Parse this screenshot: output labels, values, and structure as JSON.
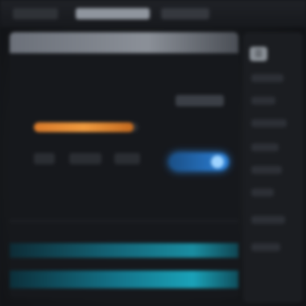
{
  "topbar": {
    "tabs": [
      "",
      "",
      ""
    ]
  },
  "main_panel": {
    "header_label": "",
    "section_label": "",
    "metric_title": "",
    "side_caption": "",
    "progress_fraction": 0.95,
    "toggle_on": true,
    "lower_label": ""
  },
  "colors": {
    "accent_orange": "#f09a3e",
    "accent_blue": "#2b7fd6",
    "accent_teal": "#1aa2b8",
    "background": "#15171b"
  },
  "right_rail": {
    "icon": "menu-icon",
    "item_count": 8
  }
}
